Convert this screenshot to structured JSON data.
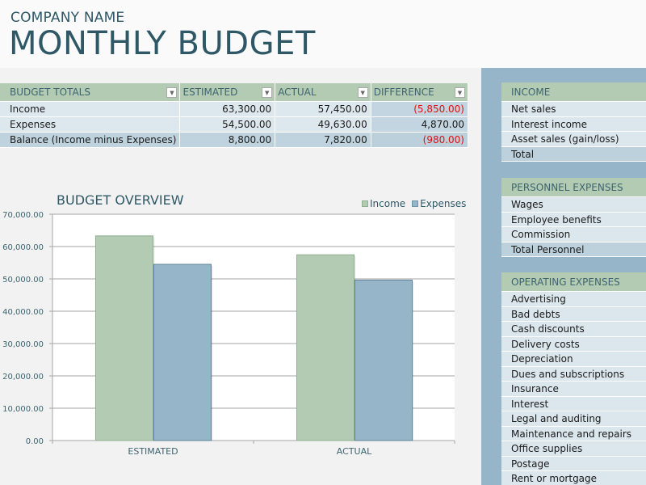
{
  "header": {
    "company": "COMPANY NAME",
    "title": "MONTHLY BUDGET"
  },
  "totals": {
    "columns": [
      "BUDGET TOTALS",
      "ESTIMATED",
      "ACTUAL",
      "DIFFERENCE"
    ],
    "rows": [
      {
        "label": "Income",
        "estimated": "63,300.00",
        "actual": "57,450.00",
        "difference": "(5,850.00)",
        "negative": true
      },
      {
        "label": "Expenses",
        "estimated": "54,500.00",
        "actual": "49,630.00",
        "difference": "4,870.00",
        "negative": false
      },
      {
        "label": "Balance (Income minus Expenses)",
        "estimated": "8,800.00",
        "actual": "7,820.00",
        "difference": "(980.00)",
        "negative": true
      }
    ],
    "dropdown_icon": "filter-dropdown-arrow"
  },
  "colors": {
    "income": "#b3cbb2",
    "expenses": "#97b5c9",
    "title": "#2f5866",
    "negative": "#dd1111"
  },
  "chart_data": {
    "type": "bar",
    "title": "BUDGET OVERVIEW",
    "categories": [
      "ESTIMATED",
      "ACTUAL"
    ],
    "series": [
      {
        "name": "Income",
        "values": [
          63300,
          57450
        ]
      },
      {
        "name": "Expenses",
        "values": [
          54500,
          49630
        ]
      }
    ],
    "xlabel": "",
    "ylabel": "",
    "ylim": [
      0,
      70000
    ],
    "yticks": [
      0,
      10000,
      20000,
      30000,
      40000,
      50000,
      60000,
      70000
    ],
    "ytick_labels": [
      "0.00",
      "10,000.00",
      "20,000.00",
      "30,000.00",
      "40,000.00",
      "50,000.00",
      "60,000.00",
      "70,000.00"
    ],
    "grid": true,
    "legend": "top-right"
  },
  "side": {
    "income": {
      "title": "INCOME",
      "items": [
        "Net sales",
        "Interest income",
        "Asset sales (gain/loss)"
      ],
      "total": "Total"
    },
    "personnel": {
      "title": "PERSONNEL EXPENSES",
      "items": [
        "Wages",
        "Employee benefits",
        "Commission"
      ],
      "total": "Total Personnel"
    },
    "operating": {
      "title": "OPERATING EXPENSES",
      "items": [
        "Advertising",
        "Bad debts",
        "Cash discounts",
        "Delivery costs",
        "Depreciation",
        "Dues and subscriptions",
        "Insurance",
        "Interest",
        "Legal and auditing",
        "Maintenance and repairs",
        "Office supplies",
        "Postage",
        "Rent or mortgage"
      ]
    }
  }
}
